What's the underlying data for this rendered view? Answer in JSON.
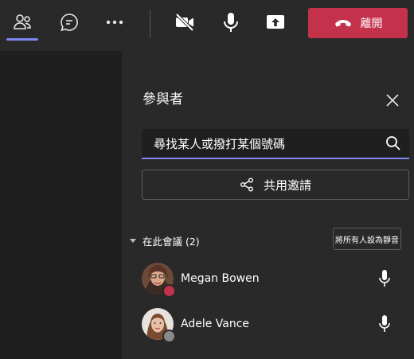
{
  "toolbar": {
    "people_icon": "people-icon",
    "chat_icon": "chat-icon",
    "more_icon": "more-icon",
    "camera_icon": "camera-off-icon",
    "mic_icon": "microphone-icon",
    "share_icon": "share-screen-icon",
    "leave_label": "離開",
    "leave_color": "#c4314b",
    "accent_color": "#7f85f5"
  },
  "panel": {
    "title": "參與者",
    "search_text": "尋找某人或撥打某個號碼",
    "share_invite_label": "共用邀請",
    "section_label": "在此會議 (2)",
    "mute_all_label": "將所有人設為靜音"
  },
  "participants": [
    {
      "name": "Megan Bowen",
      "status_color": "#c4314b"
    },
    {
      "name": "Adele Vance",
      "status_color": "#8a8a8a"
    }
  ]
}
